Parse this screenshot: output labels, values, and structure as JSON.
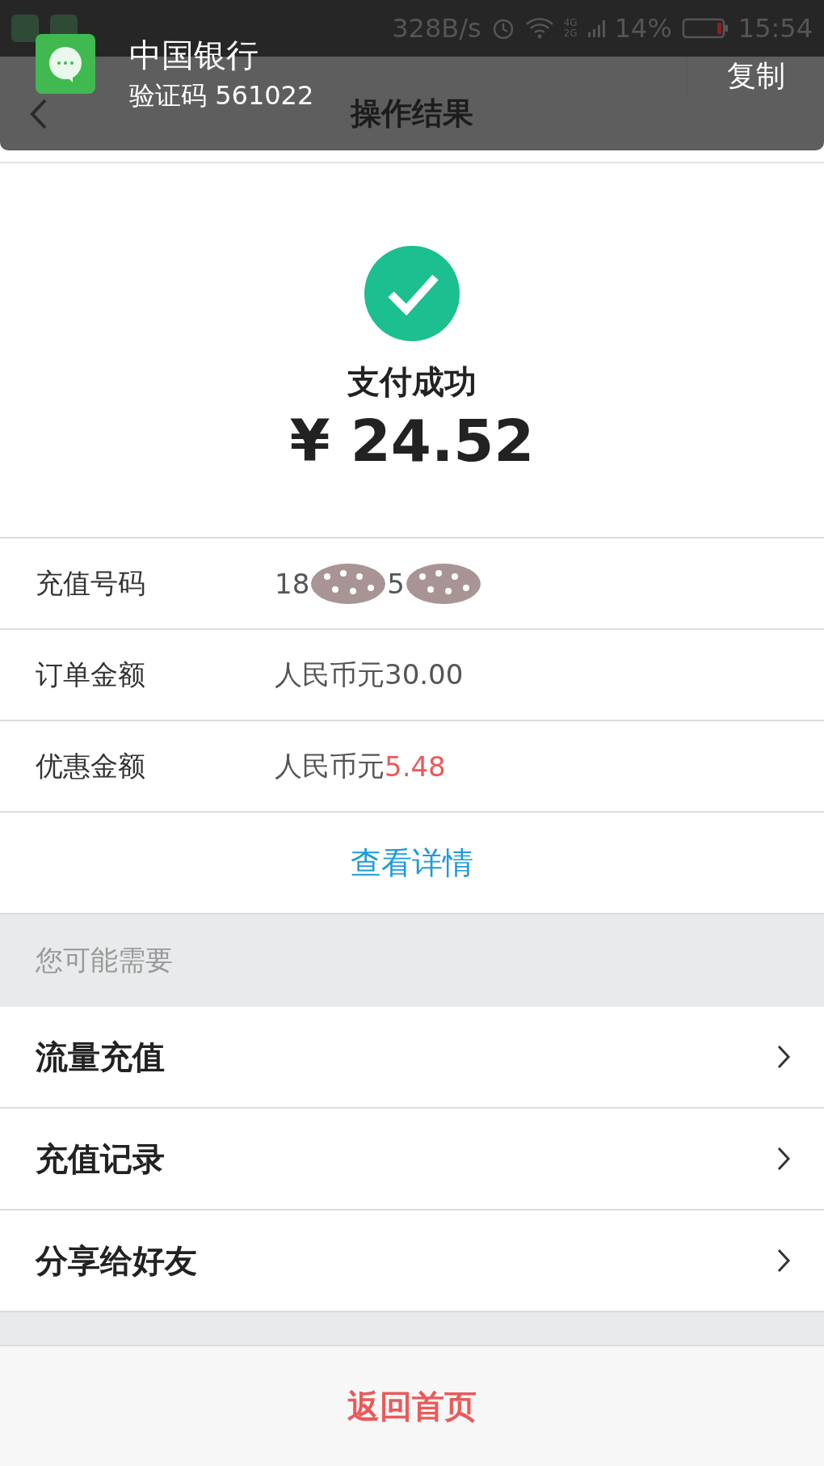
{
  "status_bar": {
    "speed": "328B/s",
    "battery": "14%",
    "time": "15:54",
    "network": "4G",
    "network2": "2G"
  },
  "notification": {
    "title": "中国银行",
    "message": "验证码 561022",
    "action": "复制"
  },
  "header": {
    "title": "操作结果"
  },
  "result": {
    "status": "支付成功",
    "amount": "¥ 24.52"
  },
  "details": [
    {
      "label": "充值号码",
      "value": [
        {
          "kind": "text",
          "text": "18"
        },
        {
          "kind": "redacted"
        },
        {
          "kind": "text",
          "text": "5"
        },
        {
          "kind": "redacted"
        }
      ]
    },
    {
      "label": "订单金额",
      "value": [
        {
          "kind": "text",
          "text": "人民币元30.00"
        }
      ]
    },
    {
      "label": "优惠金额",
      "value": [
        {
          "kind": "text",
          "text": "人民币元 "
        },
        {
          "kind": "highlight",
          "text": "5.48"
        }
      ]
    }
  ],
  "detail_link": "查看详情",
  "section_title": "您可能需要",
  "menu": [
    {
      "label": "流量充值"
    },
    {
      "label": "充值记录"
    },
    {
      "label": "分享给好友"
    }
  ],
  "home_button": "返回首页"
}
